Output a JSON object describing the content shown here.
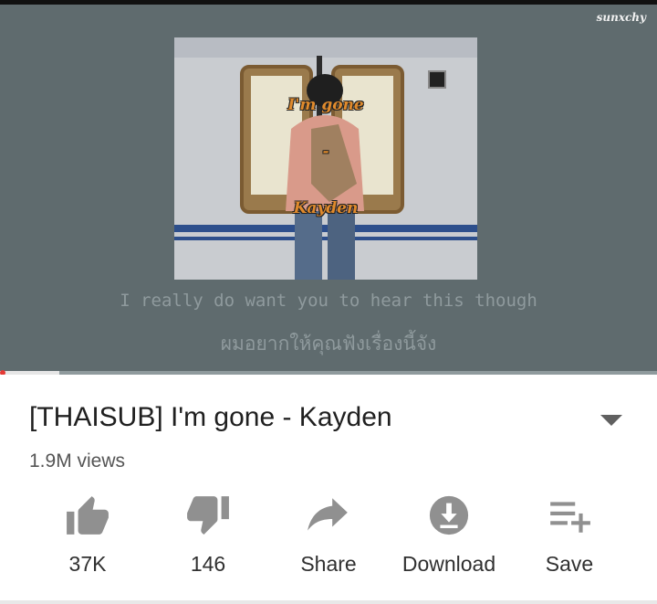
{
  "player": {
    "watermark": "sunxchy",
    "thumbnail_text_line1": "I'm gone",
    "thumbnail_text_line2": "-",
    "thumbnail_text_line3": "Kayden",
    "caption_en": "I really do want you to hear this though",
    "caption_th": "ผมอยากให้คุณฟังเรื่องนี้จัง",
    "progress_fraction": 0.09
  },
  "video": {
    "title": "[THAISUB] I'm gone - Kayden",
    "views": "1.9M views"
  },
  "actions": [
    {
      "icon": "thumbs-up-icon",
      "label": "37K"
    },
    {
      "icon": "thumbs-down-icon",
      "label": "146"
    },
    {
      "icon": "share-icon",
      "label": "Share"
    },
    {
      "icon": "download-icon",
      "label": "Download"
    },
    {
      "icon": "playlist-add-icon",
      "label": "Save"
    }
  ],
  "colors": {
    "icon_gray": "#909090",
    "player_bg": "#5f6b6e",
    "progress_red": "#e53935"
  }
}
